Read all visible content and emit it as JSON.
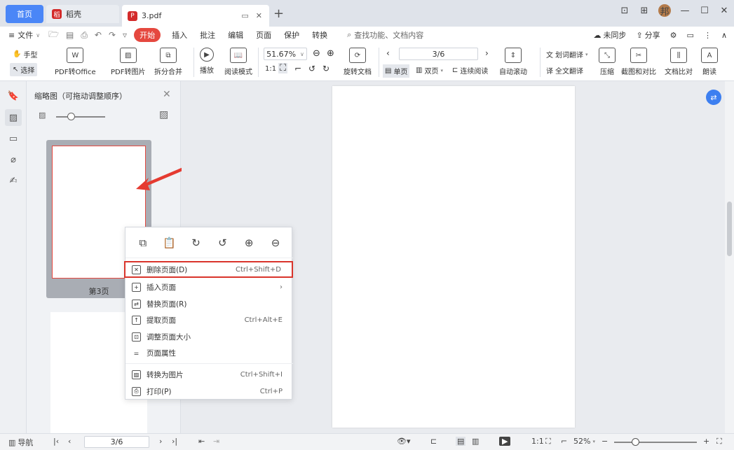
{
  "tabs": {
    "home": "首页",
    "docer": "稻壳",
    "pdf": "3.pdf",
    "add": "+"
  },
  "window": {
    "avatar": "邦",
    "restore_icon": "restore-icon"
  },
  "menubar": {
    "file": "文件",
    "start": "开始",
    "items": [
      "插入",
      "批注",
      "编辑",
      "页面",
      "保护",
      "转换"
    ],
    "search": "查找功能、文档内容",
    "sync": "未同步",
    "share": "分享"
  },
  "toolbar": {
    "hand": "手型",
    "select": "选择",
    "pdf_to_office": "PDF转Office",
    "pdf_to_image": "PDF转图片",
    "split_merge": "拆分合并",
    "play": "播放",
    "read_mode": "阅读模式",
    "zoom": "51.67%",
    "rotate_doc": "旋转文档",
    "page_value": "3/6",
    "single": "单页",
    "double": "双页",
    "continuous": "连续阅读",
    "auto_scroll": "自动滚动",
    "word_translate": "划词翻译",
    "full_translate": "全文翻译",
    "compress": "压缩",
    "screenshot": "截图和对比",
    "doc_compare": "文档比对",
    "read_aloud": "朗读"
  },
  "thumbnail": {
    "title": "缩略图（可拖动调整顺序）",
    "page_label": "第3页"
  },
  "context_menu": {
    "items": [
      {
        "label": "删除页面(D)",
        "shortcut": "Ctrl+Shift+D"
      },
      {
        "label": "插入页面",
        "shortcut": "›"
      },
      {
        "label": "替换页面(R)",
        "shortcut": ""
      },
      {
        "label": "提取页面",
        "shortcut": "Ctrl+Alt+E"
      },
      {
        "label": "调整页面大小",
        "shortcut": ""
      },
      {
        "label": "页面属性",
        "shortcut": ""
      },
      {
        "label": "转换为图片",
        "shortcut": "Ctrl+Shift+I"
      },
      {
        "label": "打印(P)",
        "shortcut": "Ctrl+P"
      }
    ]
  },
  "statusbar": {
    "nav": "导航",
    "page": "3/6",
    "zoom": "52%"
  },
  "colors": {
    "accent": "#4a86f7",
    "start_red": "#e5483f",
    "highlight_red": "#d9342b"
  }
}
